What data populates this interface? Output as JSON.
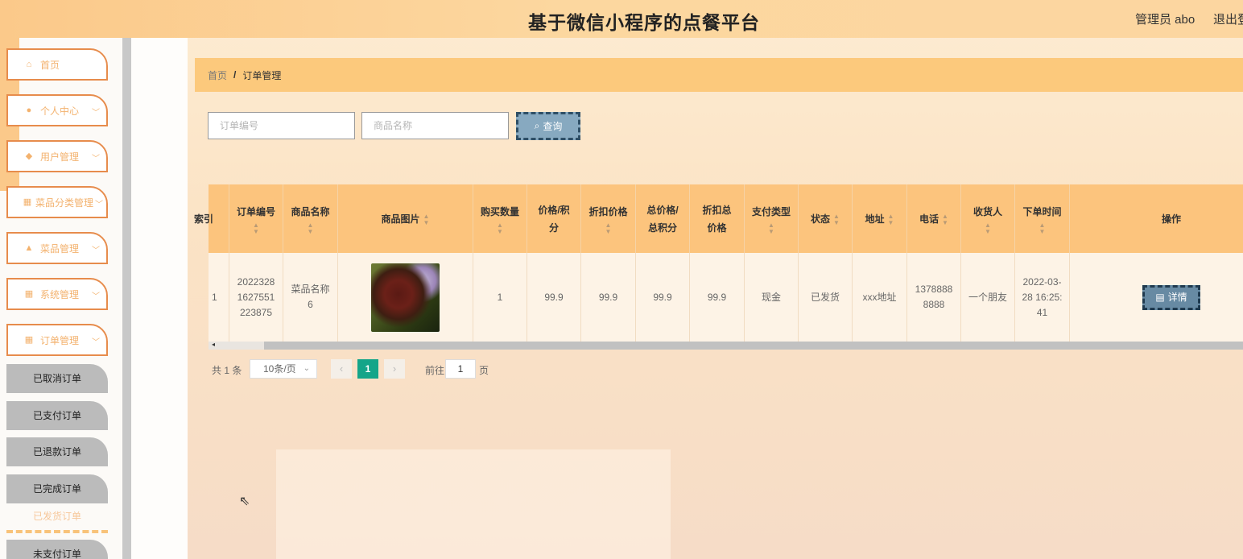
{
  "header": {
    "title": "基于微信小程序的点餐平台",
    "user": "管理员 abo",
    "logout": "退出登"
  },
  "sidebar": {
    "items": [
      {
        "label": "首页",
        "icon": "home-icon",
        "glyph": "⌂"
      },
      {
        "label": "个人中心",
        "icon": "user-icon",
        "glyph": "●"
      },
      {
        "label": "用户管理",
        "icon": "shield-icon",
        "glyph": "◆"
      },
      {
        "label": "菜品分类管理",
        "icon": "grid-icon",
        "glyph": "▦"
      },
      {
        "label": "菜品管理",
        "icon": "thumb-icon",
        "glyph": "▲"
      },
      {
        "label": "系统管理",
        "icon": "grid-icon",
        "glyph": "▦"
      },
      {
        "label": "订单管理",
        "icon": "grid-icon",
        "glyph": "▦"
      }
    ],
    "sub_items": [
      "已取消订单",
      "已支付订单",
      "已退款订单",
      "已完成订单",
      "已发货订单",
      "未支付订单"
    ]
  },
  "breadcrumb": {
    "home": "首页",
    "separator": "/",
    "current": "订单管理"
  },
  "search": {
    "order_no_placeholder": "订单编号",
    "product_name_placeholder": "商品名称",
    "query_label": "查询"
  },
  "table": {
    "headers": {
      "index": "索引",
      "order_no": "订单编号",
      "product_name": "商品名称",
      "image": "商品图片",
      "quantity": "购买数量",
      "price": "价格/积分",
      "discount_price": "折扣价格",
      "total": "总价格/总积分",
      "discount_total": "折扣总价格",
      "pay_type": "支付类型",
      "status": "状态",
      "address": "地址",
      "phone": "电话",
      "receiver": "收货人",
      "order_time": "下单时间",
      "actions": "操作"
    },
    "rows": [
      {
        "index": "1",
        "order_no": "20223281627551223875",
        "product_name": "菜品名称6",
        "quantity": "1",
        "price": "99.9",
        "discount_price": "99.9",
        "total": "99.9",
        "discount_total": "99.9",
        "pay_type": "现金",
        "status": "已发货",
        "address": "xxx地址",
        "phone": "13788888888",
        "receiver": "一个朋友",
        "order_time": "2022-03-28 16:25:41",
        "detail_label": "详情"
      }
    ]
  },
  "pagination": {
    "total": "共 1 条",
    "page_size": "10条/页",
    "current_page": "1",
    "goto_label": "前往",
    "goto_value": "1",
    "page_label": "页"
  },
  "colors": {
    "accent_orange": "#fcc47d",
    "border_orange": "#e78c4c",
    "pager_active": "#14a589",
    "button_blue": "#87a9c0"
  }
}
